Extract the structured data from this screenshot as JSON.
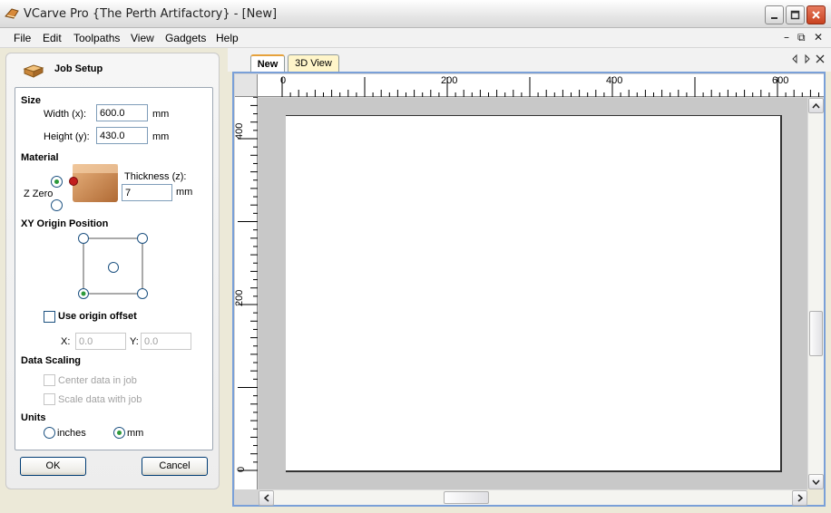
{
  "window": {
    "title": "VCarve Pro {The Perth Artifactory} - [New]",
    "controls": [
      "minimize",
      "maximize",
      "close"
    ]
  },
  "menu": {
    "items": [
      "File",
      "Edit",
      "Toolpaths",
      "View",
      "Gadgets",
      "Help"
    ],
    "mdi_controls": [
      "–",
      "⧉",
      "✕"
    ]
  },
  "panel": {
    "title": "Job Setup",
    "size": {
      "heading": "Size",
      "width_label": "Width (x):",
      "width_value": "600.0",
      "width_unit": "mm",
      "height_label": "Height (y):",
      "height_value": "430.0",
      "height_unit": "mm"
    },
    "material": {
      "heading": "Material",
      "zzero_label": "Z Zero",
      "zzero_selected": "top",
      "thickness_label": "Thickness (z):",
      "thickness_value": "7",
      "thickness_unit": "mm"
    },
    "xy_origin": {
      "heading": "XY Origin Position",
      "selected": "bottom-left",
      "use_offset_label": "Use origin offset",
      "use_offset_checked": false,
      "x_label": "X:",
      "x_value": "0.0",
      "y_label": "Y:",
      "y_value": "0.0"
    },
    "data_scaling": {
      "heading": "Data Scaling",
      "center_label": "Center data in job",
      "scale_label": "Scale data with job"
    },
    "units": {
      "heading": "Units",
      "inches_label": "inches",
      "mm_label": "mm",
      "selected": "mm"
    },
    "ok_label": "OK",
    "cancel_label": "Cancel"
  },
  "tabs": [
    {
      "label": "New",
      "active": true
    },
    {
      "label": "3D View",
      "active": false
    }
  ],
  "ruler": {
    "top_labels": [
      "0",
      "200",
      "400",
      "600"
    ],
    "left_labels": [
      "400",
      "200",
      "0"
    ]
  },
  "colors": {
    "accent_green": "#2E9A3B",
    "tab_highlight": "#E6A23C",
    "frame_blue": "#7AA0D8"
  }
}
